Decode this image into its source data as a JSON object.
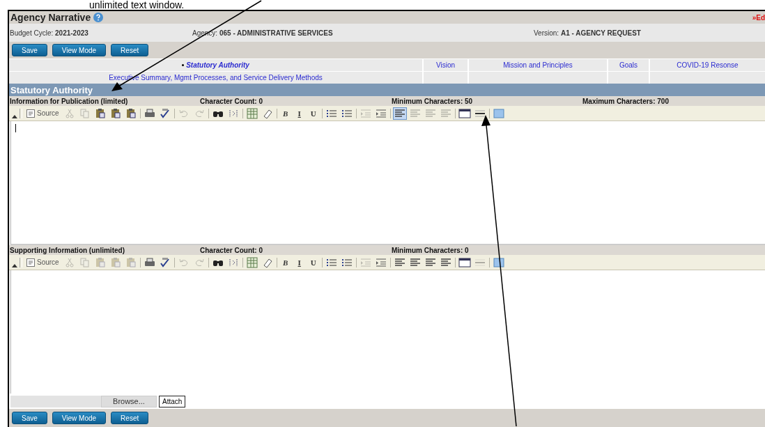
{
  "annotation": {
    "text": "unlimited text window."
  },
  "header": {
    "title": "Agency Narrative",
    "edit_link": "»Ed"
  },
  "info": [
    "Budget Cycle: **2021-2023**",
    "Agency: **065 - ADMINISTRATIVE SERVICES**",
    "Version: **A1 - AGENCY REQUEST**"
  ],
  "top_buttons": [
    "Save",
    "View Mode",
    "Reset"
  ],
  "bottom_buttons": [
    "Save",
    "View Mode",
    "Reset"
  ],
  "nav": [
    [
      {
        "label": "Statutory Authority",
        "selected": true
      },
      {
        "label": "Vision",
        "selected": false
      },
      {
        "label": "Mission and Principles",
        "selected": false
      },
      {
        "label": "Goals",
        "selected": false
      },
      {
        "label": "COVID-19 Resonse",
        "selected": false
      }
    ],
    [
      {
        "label": "Executive Summary, Mgmt Processes, and Service Delivery Methods",
        "selected": false
      }
    ]
  ],
  "section_title": "Statutory Authority",
  "editors": [
    {
      "title": "Information for Publication (limited)",
      "char_count": "Character Count: 0",
      "min_chars": "Minimum Characters: 50",
      "max_chars": "Maximum Characters: 700",
      "focused": true,
      "toolbar": [
        {
          "kind": "source",
          "label": "Source",
          "disabled": false,
          "selected": false
        },
        {
          "kind": "cut",
          "disabled": true,
          "selected": false
        },
        {
          "kind": "copy",
          "disabled": true,
          "selected": false
        },
        {
          "kind": "paste",
          "disabled": false,
          "selected": false
        },
        {
          "kind": "paste",
          "disabled": false,
          "selected": false
        },
        {
          "kind": "paste",
          "disabled": false,
          "selected": false
        },
        {
          "kind": "sep"
        },
        {
          "kind": "print",
          "disabled": false,
          "selected": false
        },
        {
          "kind": "spell",
          "disabled": false,
          "selected": false
        },
        {
          "kind": "sep"
        },
        {
          "kind": "undo",
          "disabled": true,
          "selected": false
        },
        {
          "kind": "redo",
          "disabled": true,
          "selected": false
        },
        {
          "kind": "sep"
        },
        {
          "kind": "find",
          "disabled": false,
          "selected": false
        },
        {
          "kind": "replace",
          "disabled": false,
          "selected": false
        },
        {
          "kind": "sep"
        },
        {
          "kind": "table",
          "disabled": false,
          "selected": false
        },
        {
          "kind": "eraser",
          "disabled": false,
          "selected": false
        },
        {
          "kind": "sep"
        },
        {
          "kind": "text",
          "label": "B",
          "disabled": false,
          "selected": false
        },
        {
          "kind": "text",
          "label": "I",
          "disabled": false,
          "selected": false
        },
        {
          "kind": "text",
          "label": "U",
          "disabled": false,
          "selected": false
        },
        {
          "kind": "sep"
        },
        {
          "kind": "list",
          "disabled": false,
          "selected": false
        },
        {
          "kind": "list",
          "disabled": false,
          "selected": false
        },
        {
          "kind": "sep"
        },
        {
          "kind": "indent",
          "disabled": true,
          "selected": false
        },
        {
          "kind": "indent",
          "disabled": false,
          "selected": false
        },
        {
          "kind": "sep"
        },
        {
          "kind": "align",
          "disabled": false,
          "selected": true
        },
        {
          "kind": "align",
          "disabled": true,
          "selected": false
        },
        {
          "kind": "align",
          "disabled": true,
          "selected": false
        },
        {
          "kind": "align",
          "disabled": true,
          "selected": false
        },
        {
          "kind": "sep"
        },
        {
          "kind": "block",
          "disabled": false,
          "selected": false
        },
        {
          "kind": "rule",
          "disabled": false,
          "selected": false
        },
        {
          "kind": "sep"
        },
        {
          "kind": "image",
          "disabled": false,
          "selected": false
        }
      ]
    },
    {
      "title": "Supporting Information (unlimited)",
      "char_count": "Character Count: 0",
      "min_chars": "Minimum Characters: 0",
      "focused": false,
      "toolbar": [
        {
          "kind": "source",
          "label": "Source",
          "disabled": false,
          "selected": false
        },
        {
          "kind": "cut",
          "disabled": true,
          "selected": false
        },
        {
          "kind": "copy",
          "disabled": true,
          "selected": false
        },
        {
          "kind": "paste",
          "disabled": true,
          "selected": false
        },
        {
          "kind": "paste",
          "disabled": true,
          "selected": false
        },
        {
          "kind": "paste",
          "disabled": true,
          "selected": false
        },
        {
          "kind": "sep"
        },
        {
          "kind": "print",
          "disabled": false,
          "selected": false
        },
        {
          "kind": "spell",
          "disabled": false,
          "selected": false
        },
        {
          "kind": "sep"
        },
        {
          "kind": "undo",
          "disabled": true,
          "selected": false
        },
        {
          "kind": "redo",
          "disabled": true,
          "selected": false
        },
        {
          "kind": "sep"
        },
        {
          "kind": "find",
          "disabled": false,
          "selected": false
        },
        {
          "kind": "replace",
          "disabled": false,
          "selected": false
        },
        {
          "kind": "sep"
        },
        {
          "kind": "table",
          "disabled": false,
          "selected": false
        },
        {
          "kind": "eraser",
          "disabled": false,
          "selected": false
        },
        {
          "kind": "sep"
        },
        {
          "kind": "text",
          "label": "B",
          "disabled": false,
          "selected": false
        },
        {
          "kind": "text",
          "label": "I",
          "disabled": false,
          "selected": false
        },
        {
          "kind": "text",
          "label": "U",
          "disabled": false,
          "selected": false
        },
        {
          "kind": "sep"
        },
        {
          "kind": "list",
          "disabled": false,
          "selected": false
        },
        {
          "kind": "list",
          "disabled": false,
          "selected": false
        },
        {
          "kind": "sep"
        },
        {
          "kind": "indent",
          "disabled": true,
          "selected": false
        },
        {
          "kind": "indent",
          "disabled": false,
          "selected": false
        },
        {
          "kind": "sep"
        },
        {
          "kind": "align",
          "disabled": false,
          "selected": false
        },
        {
          "kind": "align",
          "disabled": false,
          "selected": false
        },
        {
          "kind": "align",
          "disabled": false,
          "selected": false
        },
        {
          "kind": "align",
          "disabled": false,
          "selected": false
        },
        {
          "kind": "sep"
        },
        {
          "kind": "block",
          "disabled": false,
          "selected": false
        },
        {
          "kind": "rule",
          "disabled": true,
          "selected": false
        },
        {
          "kind": "sep"
        },
        {
          "kind": "image",
          "disabled": false,
          "selected": false
        }
      ]
    }
  ],
  "attach": {
    "browse": "Browse...",
    "attach": "Attach"
  }
}
